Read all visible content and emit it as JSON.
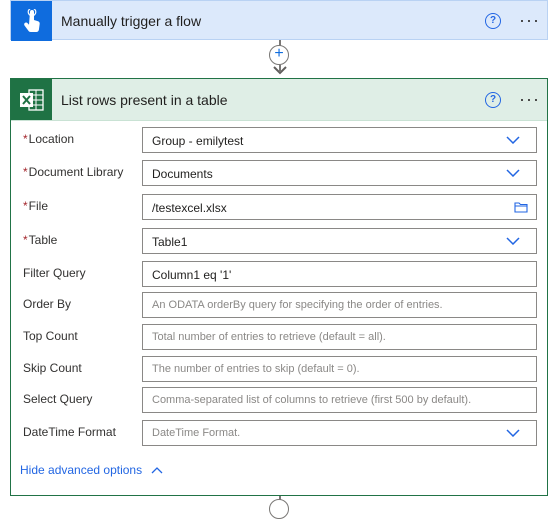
{
  "trigger": {
    "title": "Manually trigger a flow",
    "help_icon": "question-circle-icon",
    "menu_icon": "more-horizontal-icon",
    "icon": "hand-tap-icon",
    "accent": "#0f6cde"
  },
  "connector": {
    "add_icon": "plus-icon",
    "arrow_icon": "arrow-down-icon"
  },
  "action": {
    "title": "List rows present in a table",
    "icon": "excel-icon",
    "accent": "#1f7244",
    "help_icon": "question-circle-icon",
    "menu_icon": "more-horizontal-icon",
    "fields": [
      {
        "label": "Location",
        "required": true,
        "value": "Group - emilytest",
        "placeholder": "",
        "control": "dropdown"
      },
      {
        "label": "Document Library",
        "required": true,
        "value": "Documents",
        "placeholder": "",
        "control": "dropdown"
      },
      {
        "label": "File",
        "required": true,
        "value": "/testexcel.xlsx",
        "placeholder": "",
        "control": "file-picker"
      },
      {
        "label": "Table",
        "required": true,
        "value": "Table1",
        "placeholder": "",
        "control": "dropdown"
      },
      {
        "label": "Filter Query",
        "required": false,
        "value": "Column1 eq '1'",
        "placeholder": "",
        "control": "text"
      },
      {
        "label": "Order By",
        "required": false,
        "value": "",
        "placeholder": "An ODATA orderBy query for specifying the order of entries.",
        "control": "text"
      },
      {
        "label": "Top Count",
        "required": false,
        "value": "",
        "placeholder": "Total number of entries to retrieve (default = all).",
        "control": "text"
      },
      {
        "label": "Skip Count",
        "required": false,
        "value": "",
        "placeholder": "The number of entries to skip (default = 0).",
        "control": "text"
      },
      {
        "label": "Select Query",
        "required": false,
        "value": "",
        "placeholder": "Comma-separated list of columns to retrieve (first 500 by default).",
        "control": "text"
      },
      {
        "label": "DateTime Format",
        "required": false,
        "value": "",
        "placeholder": "DateTime Format.",
        "control": "dropdown"
      }
    ],
    "hide_advanced_label": "Hide advanced options"
  }
}
